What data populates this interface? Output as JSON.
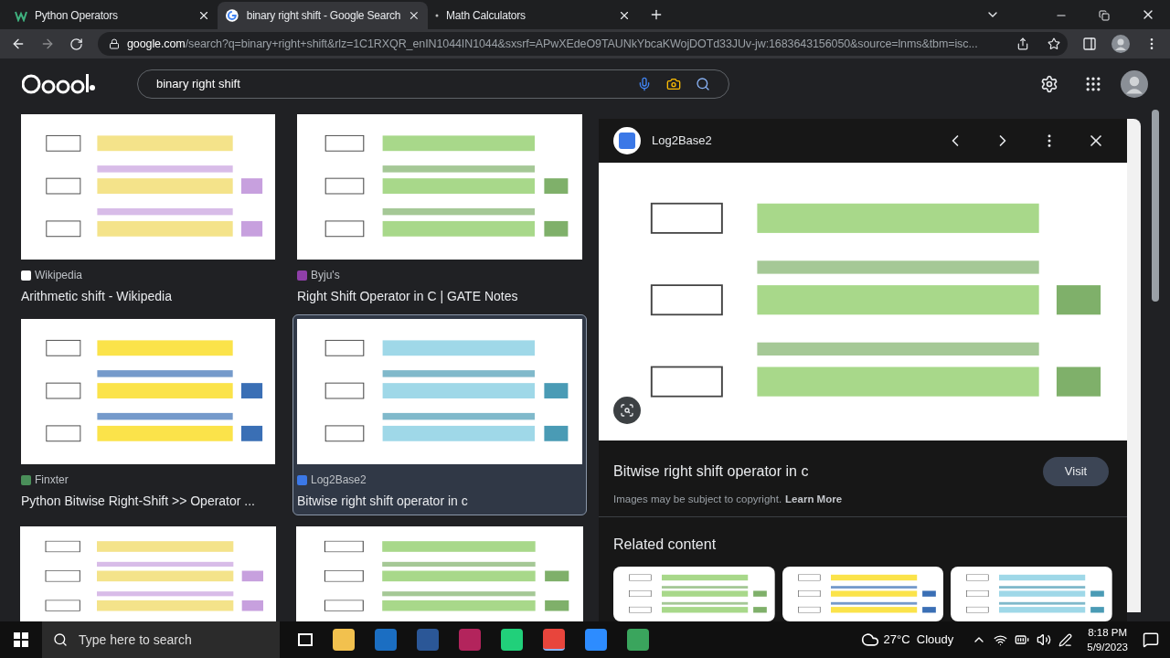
{
  "tabs": [
    {
      "title": "Python Operators",
      "selected": false
    },
    {
      "title": "binary right shift - Google Search",
      "selected": true
    },
    {
      "title": "Math Calculators",
      "selected": false
    }
  ],
  "address": {
    "domain": "google.com",
    "path": "/search?q=binary+right+shift&rlz=1C1RXQR_enIN1044IN1044&sxsrf=APwXEdeO9TAUNkYbcaKWojDOTd33JUv-jw:1683643156050&source=lnms&tbm=isc..."
  },
  "search": {
    "value": "binary right shift"
  },
  "results": [
    {
      "kind": "result",
      "source": "Wikipedia",
      "title": "Arithmetic shift - Wikipedia",
      "selected": false,
      "color": "#ffffff"
    },
    {
      "kind": "result",
      "source": "Byju's",
      "title": "Right Shift Operator in C | GATE Notes",
      "selected": false,
      "color": "#8e3fa8"
    },
    {
      "kind": "result",
      "source": "Finxter",
      "title": "Python Bitwise Right-Shift >> Operator ...",
      "selected": false,
      "color": "#4a8f5a"
    },
    {
      "kind": "result",
      "source": "Log2Base2",
      "title": "Bitwise right shift operator in c",
      "selected": true,
      "color": "#3b78e7"
    },
    {
      "kind": "picture"
    },
    {
      "kind": "picture"
    }
  ],
  "preview": {
    "source": "Log2Base2",
    "title": "Bitwise right shift operator in c",
    "button": "Visit",
    "notice": "Images may be subject to copyright.",
    "link": "Learn More",
    "related_heading": "Related content",
    "related": [
      {
        "kind": "picture"
      },
      {
        "kind": "picture"
      },
      {
        "kind": "picture"
      }
    ]
  },
  "taskbar": {
    "search_placeholder": "Type here to search",
    "weather": "27°C  Cloudy",
    "time": "8:18 PM",
    "date": "5/9/2023"
  }
}
